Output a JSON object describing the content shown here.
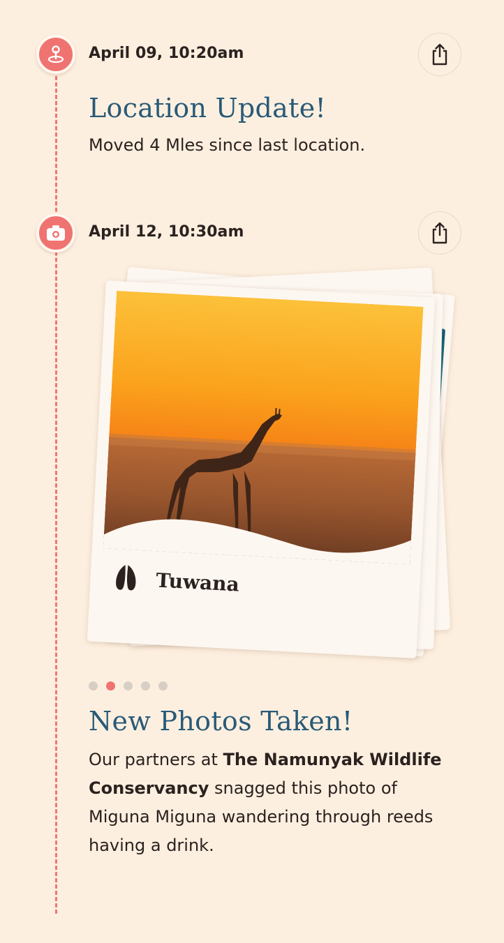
{
  "events": [
    {
      "timestamp": "April 09, 10:20am",
      "icon": "location-pin-icon",
      "headline": "Location Update!",
      "body": "Moved 4 Mles since last location."
    },
    {
      "timestamp": "April 12, 10:30am",
      "icon": "camera-icon",
      "headline": "New Photos Taken!",
      "body_part1": "Our partners at ",
      "body_bold": "The Namunyak Wildlife Conservancy",
      "body_part2": " snagged this photo of Miguna Miguna wandering through reeds having a drink.",
      "photo": {
        "caption": "Tuwana",
        "caption_icon": "hoof-print-icon",
        "subject": "giraffe-at-sunset"
      },
      "carousel": {
        "count": 5,
        "active_index": 1
      }
    }
  ],
  "share_icon": "share-icon",
  "colors": {
    "background": "#fdefdf",
    "accent": "#ef7471",
    "headline": "#285a78",
    "text": "#2b2220"
  }
}
